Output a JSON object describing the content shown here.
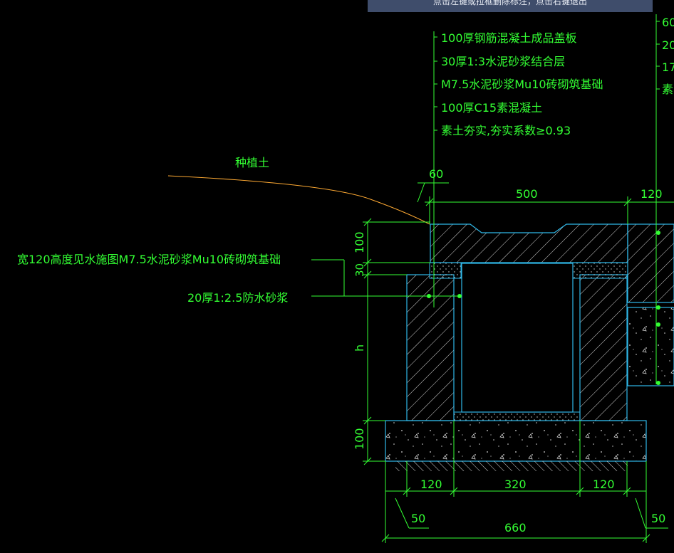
{
  "tooltip": "点击左键或拉框删除标注，点击右键退出",
  "labels": {
    "layer1": "100厚钢筋混凝土成品盖板",
    "layer2": "30厚1:3水泥砂浆结合层",
    "layer3": "M7.5水泥砂浆Mu10砖砌筑基础",
    "layer4": "100厚C15素混凝土",
    "layer5": "素土夯实,夯实系数≥0.93",
    "planting_soil": "种植土",
    "wall_note": "宽120高度见水施图M7.5水泥砂浆Mu10砖砌筑基础",
    "mortar_note": "20厚1:2.5防水砂浆",
    "right_r1": "60",
    "right_r2": "20",
    "right_r3": "17",
    "right_r4": "素"
  },
  "dims": {
    "d60": "60",
    "d500": "500",
    "d120_top": "120",
    "d100_left": "100",
    "d30_left": "30",
    "h_left": "h",
    "d100_base": "100",
    "d120_a": "120",
    "d320": "320",
    "d120_b": "120",
    "d50_a": "50",
    "d50_b": "50",
    "d660": "660"
  },
  "colors": {
    "background": "#000000",
    "text": "#33ff33",
    "outline": "#2fb8e8",
    "hatch": "#d8d8d8",
    "soil_line": "#ffaa33",
    "tooltip_bg": "#3f4d6b"
  }
}
